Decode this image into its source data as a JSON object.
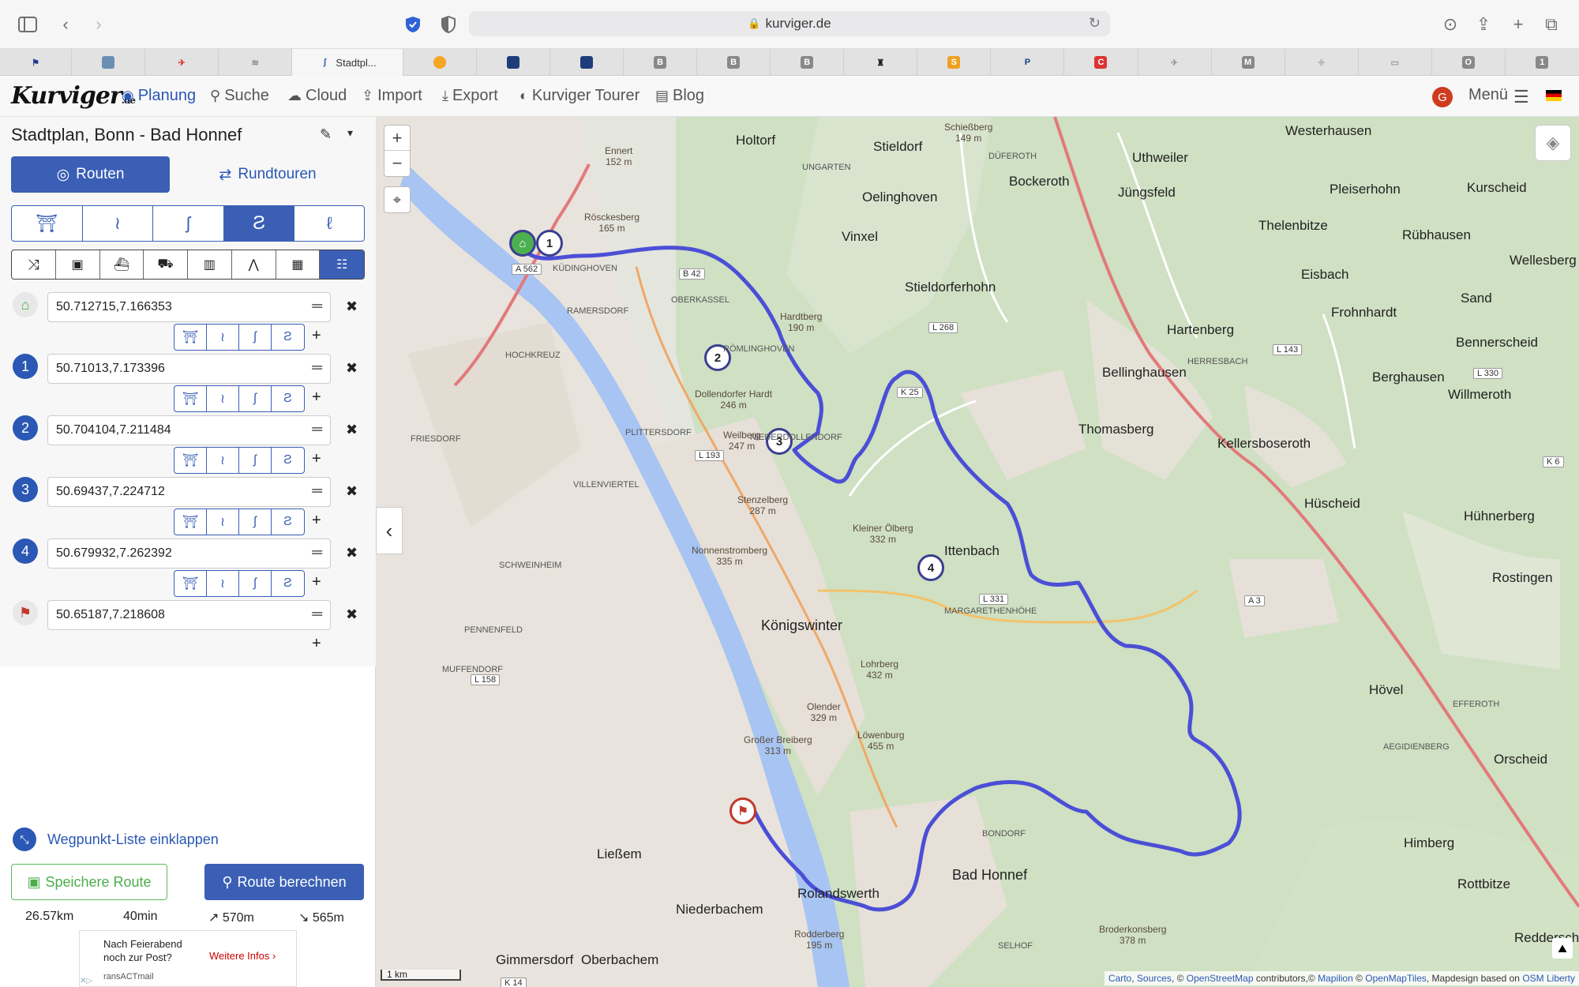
{
  "browser": {
    "url": "kurviger.de",
    "active_tab_title": "Stadtpl...",
    "tab_letters": [
      "B",
      "B",
      "B",
      "M",
      "O",
      "1"
    ]
  },
  "nav": {
    "logo_text": "Kurviger",
    "logo_suffix": ".de",
    "items": [
      "Planung",
      "Suche",
      "Cloud",
      "Import",
      "Export",
      "Kurviger Tourer",
      "Blog"
    ],
    "avatar_letter": "G",
    "menu_label": "Menü"
  },
  "panel": {
    "title": "Stadtplan, Bonn - Bad Honnef",
    "tab_routes": "Routen",
    "tab_roundtrip": "Rundtouren",
    "waypoints": [
      {
        "marker": "home",
        "value": "50.712715,7.166353"
      },
      {
        "marker": "1",
        "value": "50.71013,7.173396"
      },
      {
        "marker": "2",
        "value": "50.704104,7.211484"
      },
      {
        "marker": "3",
        "value": "50.69437,7.224712"
      },
      {
        "marker": "4",
        "value": "50.679932,7.262392"
      },
      {
        "marker": "finish",
        "value": "50.65187,7.218608"
      }
    ],
    "collapse_label": "Wegpunkt-Liste einklappen",
    "save_label": "Speichere Route",
    "calc_label": "Route berechnen",
    "stats": {
      "distance": "26.57km",
      "duration": "40min",
      "ascent": "↗ 570m",
      "descent": "↘ 565m"
    },
    "ad": {
      "line1": "Nach Feierabend",
      "line2": "noch zur Post?",
      "link": "Weitere Infos",
      "sub": "ransACTmail"
    }
  },
  "map": {
    "scale_label": "1 km",
    "attribution_parts": [
      "Carto",
      "Sources",
      "OpenStreetMap",
      "contributors,©",
      "Mapilion",
      "OpenMapTiles",
      "Mapdesign based on",
      "OSM Liberty"
    ],
    "towns": [
      "Königswinter",
      "Bad Honnef",
      "Thomasberg",
      "Bellinghausen",
      "Hartenberg",
      "Kellersboseroth",
      "Hüscheid",
      "Hühnerberg",
      "Rostingen",
      "Hövel",
      "Orscheid",
      "Himberg",
      "Rottbitze",
      "Westerhausen",
      "Uthweiler",
      "Bockeroth",
      "Jüngsfeld",
      "Pleiserhohn",
      "Kurscheid",
      "Thelenbitze",
      "Rübhausen",
      "Wellesberg",
      "Eisbach",
      "Sand",
      "Frohnhardt",
      "Bennerscheid",
      "Berghausen",
      "Willmeroth",
      "Stieldorferhohn",
      "Oelinghoven",
      "Vinxel",
      "Holtorf",
      "Stieldorf",
      "Ließem",
      "Rolandswerth",
      "Niederbachem",
      "Gimmersdorf",
      "Oberbachem",
      "Reddersche",
      "Ittenbach"
    ],
    "peaks": [
      {
        "name": "Rösckesberg",
        "elev": "165 m"
      },
      {
        "name": "Ennert",
        "elev": "152 m"
      },
      {
        "name": "Dollendorfer Hardt",
        "elev": "246 m"
      },
      {
        "name": "Weilberg",
        "elev": "247 m"
      },
      {
        "name": "Stenzelberg",
        "elev": "287 m"
      },
      {
        "name": "Nonnenstromberg",
        "elev": "335 m"
      },
      {
        "name": "Kleiner Ölberg",
        "elev": "332 m"
      },
      {
        "name": "Lohrberg",
        "elev": "432 m"
      },
      {
        "name": "Olender",
        "elev": "329 m"
      },
      {
        "name": "Großer Breiberg",
        "elev": "313 m"
      },
      {
        "name": "Löwenburg",
        "elev": "455 m"
      },
      {
        "name": "Broderkonsberg",
        "elev": "378 m"
      },
      {
        "name": "Rodderberg",
        "elev": "195 m"
      },
      {
        "name": "Schießberg",
        "elev": "149 m"
      },
      {
        "name": "Hardtberg",
        "elev": "190 m"
      }
    ],
    "districts": [
      "HOCHKREUZ",
      "FRIESDORF",
      "PLITTERSDORF",
      "VILLENVIERTEL",
      "SCHWEINHEIM",
      "PENNENFELD",
      "MUFFENDORF",
      "NIEDERDOLLENDORF",
      "RÖMLINGHOVEN",
      "RAMERSDORF",
      "KÜDINGHOVEN",
      "OBERKASSEL",
      "UNGARTEN",
      "DÜFEROTH",
      "HERRESBACH",
      "MARGARETHENHÖHE",
      "EFFEROTH",
      "BONDORF",
      "SELHOF",
      "AEGIDIENBERG"
    ],
    "roads": [
      "A 562",
      "B 42",
      "L 193",
      "K 25",
      "L 331",
      "L 158",
      "A 3",
      "L 143",
      "L 330",
      "K 6",
      "K 14",
      "L 268"
    ],
    "route_markers": [
      "1",
      "2",
      "3",
      "4"
    ]
  }
}
